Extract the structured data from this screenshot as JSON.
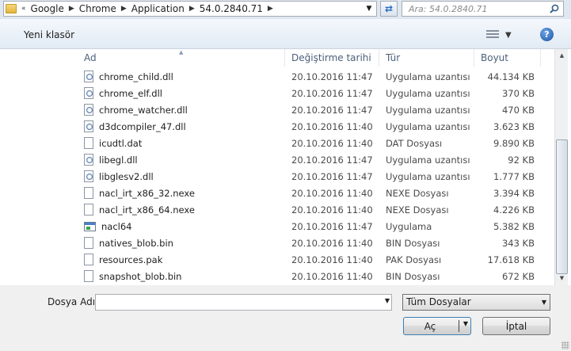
{
  "address_bar": {
    "overflow": "«",
    "crumbs": [
      "Google",
      "Chrome",
      "Application",
      "54.0.2840.71"
    ]
  },
  "search": {
    "placeholder": "Ara: 54.0.2840.71"
  },
  "toolbar": {
    "new_folder_label": "Yeni klasör",
    "help_glyph": "?"
  },
  "columns": {
    "name": "Ad",
    "date": "Değiştirme tarihi",
    "type": "Tür",
    "size": "Boyut"
  },
  "files": [
    {
      "name": "chrome_child.dll",
      "date": "20.10.2016 11:47",
      "type": "Uygulama uzantısı",
      "size": "44.134 KB",
      "icon": "dll-icon"
    },
    {
      "name": "chrome_elf.dll",
      "date": "20.10.2016 11:47",
      "type": "Uygulama uzantısı",
      "size": "370 KB",
      "icon": "dll-icon"
    },
    {
      "name": "chrome_watcher.dll",
      "date": "20.10.2016 11:47",
      "type": "Uygulama uzantısı",
      "size": "470 KB",
      "icon": "dll-icon"
    },
    {
      "name": "d3dcompiler_47.dll",
      "date": "20.10.2016 11:40",
      "type": "Uygulama uzantısı",
      "size": "3.623 KB",
      "icon": "dll-icon"
    },
    {
      "name": "icudtl.dat",
      "date": "20.10.2016 11:40",
      "type": "DAT Dosyası",
      "size": "9.890 KB",
      "icon": "file-icon"
    },
    {
      "name": "libegl.dll",
      "date": "20.10.2016 11:47",
      "type": "Uygulama uzantısı",
      "size": "92 KB",
      "icon": "dll-icon"
    },
    {
      "name": "libglesv2.dll",
      "date": "20.10.2016 11:47",
      "type": "Uygulama uzantısı",
      "size": "1.777 KB",
      "icon": "dll-icon"
    },
    {
      "name": "nacl_irt_x86_32.nexe",
      "date": "20.10.2016 11:40",
      "type": "NEXE Dosyası",
      "size": "3.394 KB",
      "icon": "file-icon"
    },
    {
      "name": "nacl_irt_x86_64.nexe",
      "date": "20.10.2016 11:40",
      "type": "NEXE Dosyası",
      "size": "4.226 KB",
      "icon": "file-icon"
    },
    {
      "name": "nacl64",
      "date": "20.10.2016 11:47",
      "type": "Uygulama",
      "size": "5.382 KB",
      "icon": "exe-icon"
    },
    {
      "name": "natives_blob.bin",
      "date": "20.10.2016 11:40",
      "type": "BIN Dosyası",
      "size": "343 KB",
      "icon": "file-icon"
    },
    {
      "name": "resources.pak",
      "date": "20.10.2016 11:40",
      "type": "PAK Dosyası",
      "size": "17.618 KB",
      "icon": "file-icon"
    },
    {
      "name": "snapshot_blob.bin",
      "date": "20.10.2016 11:40",
      "type": "BIN Dosyası",
      "size": "672 KB",
      "icon": "file-icon"
    }
  ],
  "bottom": {
    "filename_label": "Dosya Adı:",
    "filename_value": "",
    "filetype_selected": "Tüm Dosyalar",
    "open_label": "Aç",
    "cancel_label": "İptal"
  }
}
